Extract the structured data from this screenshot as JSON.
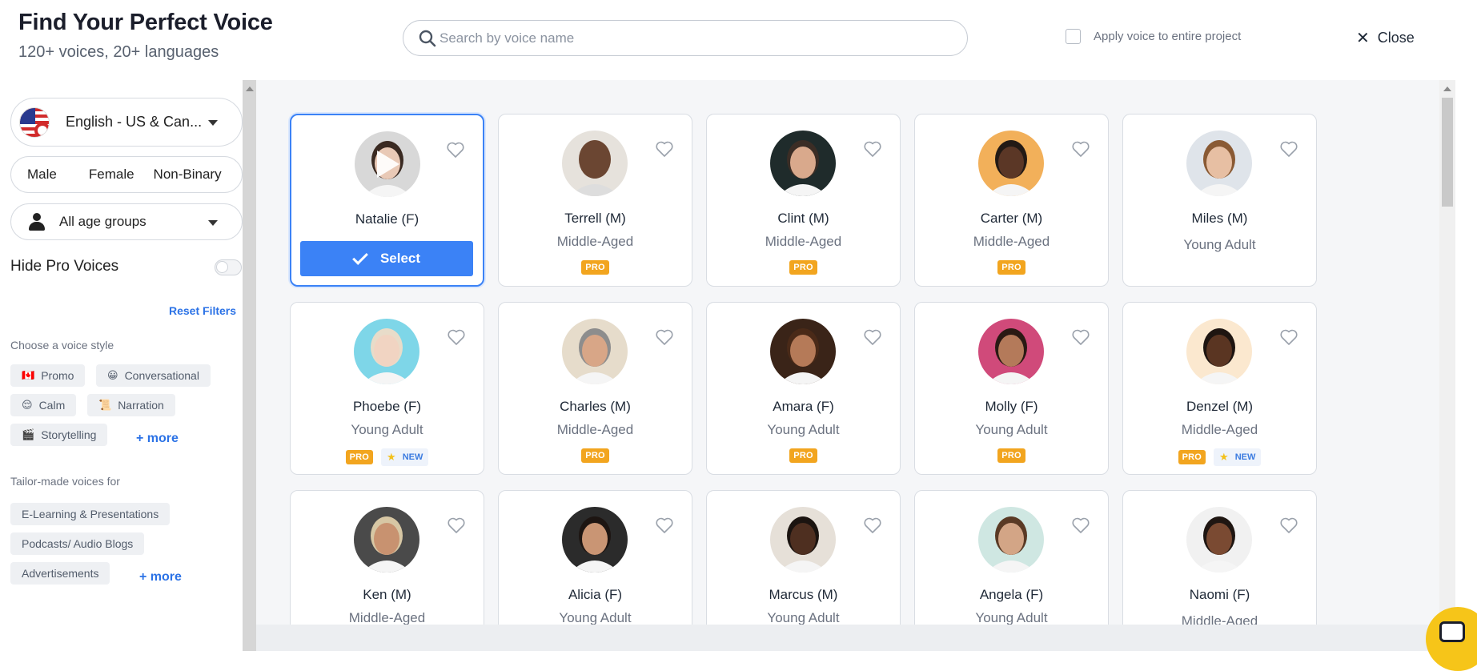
{
  "header": {
    "title": "Find Your Perfect Voice",
    "subtitle": "120+ voices, 20+ languages",
    "search_placeholder": "Search by voice name",
    "apply_label": "Apply voice to entire project",
    "close_label": "Close"
  },
  "sidebar": {
    "language": "English - US & Can...",
    "genders": [
      "Male",
      "Female",
      "Non-Binary"
    ],
    "age_group": "All age groups",
    "hide_pro_label": "Hide Pro Voices",
    "reset_label": "Reset Filters",
    "style_heading": "Choose a voice style",
    "styles": [
      {
        "emoji": "🇨🇦",
        "label": "Promo"
      },
      {
        "emoji": "😀",
        "label": "Conversational"
      },
      {
        "emoji": "😌",
        "label": "Calm"
      },
      {
        "emoji": "📜",
        "label": "Narration"
      },
      {
        "emoji": "🎬",
        "label": "Storytelling"
      }
    ],
    "styles_more": "+ more",
    "tailor_heading": "Tailor-made voices for",
    "tailor": [
      "E-Learning & Presentations",
      "Podcasts/ Audio Blogs",
      "Advertisements"
    ],
    "tailor_more": "+ more"
  },
  "select_label": "Select",
  "pro_label": "PRO",
  "new_label": "NEW",
  "voices": [
    {
      "name": "Natalie (F)",
      "age": "",
      "pro": false,
      "new": false,
      "selected": true,
      "skin": "#e9c9b6",
      "hair": "#3a2a22",
      "bg": "#d8d8d8"
    },
    {
      "name": "Terrell (M)",
      "age": "Middle-Aged",
      "pro": true,
      "new": false,
      "skin": "#6b4632",
      "hair": "#6b4632",
      "bg": "#e6e2dc"
    },
    {
      "name": "Clint (M)",
      "age": "Middle-Aged",
      "pro": true,
      "new": false,
      "skin": "#d9a98c",
      "hair": "#3b2d25",
      "bg": "#1f2b2b"
    },
    {
      "name": "Carter (M)",
      "age": "Middle-Aged",
      "pro": true,
      "new": false,
      "skin": "#5b3726",
      "hair": "#231a15",
      "bg": "#f2b05a"
    },
    {
      "name": "Miles (M)",
      "age": "Young Adult",
      "pro": false,
      "new": false,
      "skin": "#e7bfa3",
      "hair": "#8a5a34",
      "bg": "#dfe4ea"
    },
    {
      "name": "Phoebe (F)",
      "age": "Young Adult",
      "pro": true,
      "new": true,
      "skin": "#f1d4c2",
      "hair": "#e8dcc9",
      "bg": "#7ed6e8"
    },
    {
      "name": "Charles (M)",
      "age": "Middle-Aged",
      "pro": true,
      "new": false,
      "skin": "#d8a687",
      "hair": "#8d8d8d",
      "bg": "#e6dccb"
    },
    {
      "name": "Amara (F)",
      "age": "Young Adult",
      "pro": true,
      "new": false,
      "skin": "#b57a58",
      "hair": "#4a2a18",
      "bg": "#3a2418"
    },
    {
      "name": "Molly (F)",
      "age": "Young Adult",
      "pro": true,
      "new": false,
      "skin": "#b47a5a",
      "hair": "#2a1a14",
      "bg": "#d04a7a"
    },
    {
      "name": "Denzel (M)",
      "age": "Middle-Aged",
      "pro": true,
      "new": true,
      "skin": "#5a3522",
      "hair": "#1e1511",
      "bg": "#fbe8cf"
    },
    {
      "name": "Ken (M)",
      "age": "Middle-Aged",
      "pro": true,
      "new": false,
      "skin": "#c89270",
      "hair": "#d7c7a4",
      "bg": "#4a4a4a"
    },
    {
      "name": "Alicia (F)",
      "age": "Young Adult",
      "pro": true,
      "new": false,
      "skin": "#c99574",
      "hair": "#1d1512",
      "bg": "#2b2b2b"
    },
    {
      "name": "Marcus (M)",
      "age": "Young Adult",
      "pro": true,
      "new": false,
      "skin": "#4e2f20",
      "hair": "#1b1410",
      "bg": "#e6e0d8"
    },
    {
      "name": "Angela (F)",
      "age": "Young Adult",
      "pro": true,
      "new": true,
      "skin": "#d3a586",
      "hair": "#5a3a25",
      "bg": "#cfe7e2"
    },
    {
      "name": "Naomi (F)",
      "age": "Middle-Aged",
      "pro": false,
      "new": false,
      "skin": "#7a4a32",
      "hair": "#1f1612",
      "bg": "#f1f1f1"
    }
  ]
}
